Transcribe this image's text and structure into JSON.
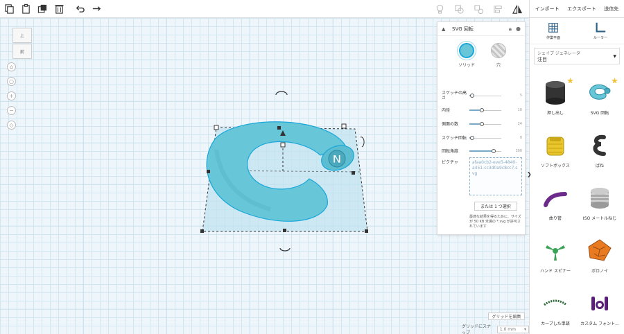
{
  "toolbar": {
    "left_icons": [
      "copy-icon",
      "paste-icon",
      "duplicate-icon",
      "trash-icon",
      "undo-icon",
      "redo-icon"
    ],
    "right_icons": [
      "light-bulb-icon",
      "group-icon",
      "ungroup-icon",
      "align-icon",
      "mirror-icon"
    ]
  },
  "top_nav": {
    "import": "インポート",
    "export": "エクスポート",
    "send_to": "送信先"
  },
  "view_cube": {
    "top": "上",
    "front": "前"
  },
  "inspector": {
    "title": "SVG 回転",
    "solid_label": "ソリッド",
    "hole_label": "穴",
    "properties": [
      {
        "label": "スケッチの高さ",
        "value": "5",
        "fraction": 0.08
      },
      {
        "label": "内径",
        "value": "10",
        "fraction": 0.4
      },
      {
        "label": "側面の数",
        "value": "24",
        "fraction": 0.4
      },
      {
        "label": "スケッチ回転",
        "value": "0",
        "fraction": 0.08
      },
      {
        "label": "回転角度",
        "value": "300",
        "fraction": 0.75
      }
    ],
    "picture_label": "ピクチャ",
    "picture_file": "afaa0cb2-eve5-4840-a451-cc3d0a9c8cc7.svg",
    "choose_button": "または 1 つ選択",
    "note": "最適な結果を得るために、サイズが 50 KB 未満の *.svg が許可されています"
  },
  "tools": {
    "workplane": "作業平面",
    "ruler": "ルーラー"
  },
  "generator": {
    "title": "シェイプ ジェネレータ",
    "value": "注目"
  },
  "shapes": [
    {
      "label": "押し出し",
      "icon": "extrude-icon",
      "starred": true
    },
    {
      "label": "SVG 回転",
      "icon": "svg-revolve-icon",
      "starred": true
    },
    {
      "label": "ソフトボックス",
      "icon": "soft-box-icon",
      "starred": false
    },
    {
      "label": "ばね",
      "icon": "spring-icon",
      "starred": false
    },
    {
      "label": "曲り管",
      "icon": "bent-pipe-icon",
      "starred": false
    },
    {
      "label": "ISO メートルねじ",
      "icon": "iso-thread-icon",
      "starred": false
    },
    {
      "label": "ハンド スピナー",
      "icon": "hand-spinner-icon",
      "starred": false
    },
    {
      "label": "ボロノイ",
      "icon": "voronoi-icon",
      "starred": false
    },
    {
      "label": "カーブした単語",
      "icon": "curved-text-icon",
      "starred": false
    },
    {
      "label": "カスタム フォント...",
      "icon": "custom-font-icon",
      "starred": false
    }
  ],
  "canvas": {
    "edit_grid": "グリッドを編集",
    "snap_label": "グリッドにスナップ",
    "snap_value": "1.0 mm"
  },
  "colors": {
    "accent": "#1aa7d9",
    "shape": "#67c6d8",
    "grid": "#d1e6f1"
  }
}
